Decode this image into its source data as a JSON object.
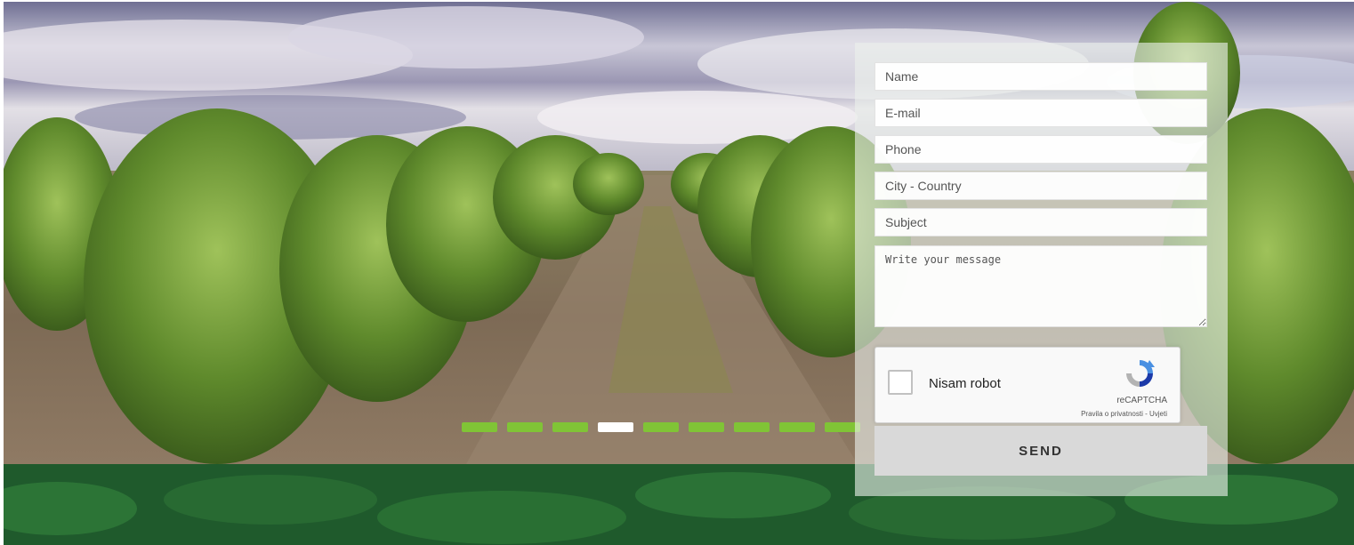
{
  "hero": {
    "background": "yerba-mate-plantation-photo",
    "colors": {
      "sky": "#b7b5c8",
      "foliage": "#5a7d2a",
      "soil": "#7c6b58"
    }
  },
  "carousel": {
    "indicator_count": 9,
    "active_index": 3,
    "color_inactive": "#80c436",
    "color_active": "#ffffff"
  },
  "contact_form": {
    "name_placeholder": "Name",
    "email_placeholder": "E-mail",
    "phone_placeholder": "Phone",
    "city_country_placeholder": "City - Country",
    "subject_placeholder": "Subject",
    "message_placeholder": "Write your message",
    "recaptcha": {
      "checkbox_label": "Nisam robot",
      "brand": "reCAPTCHA",
      "privacy_link": "Pravila o privatnosti",
      "separator": " - ",
      "terms_link": "Uvjeti"
    },
    "send_label": "SEND"
  },
  "footer_band": {
    "color": "#1f5a2c"
  }
}
